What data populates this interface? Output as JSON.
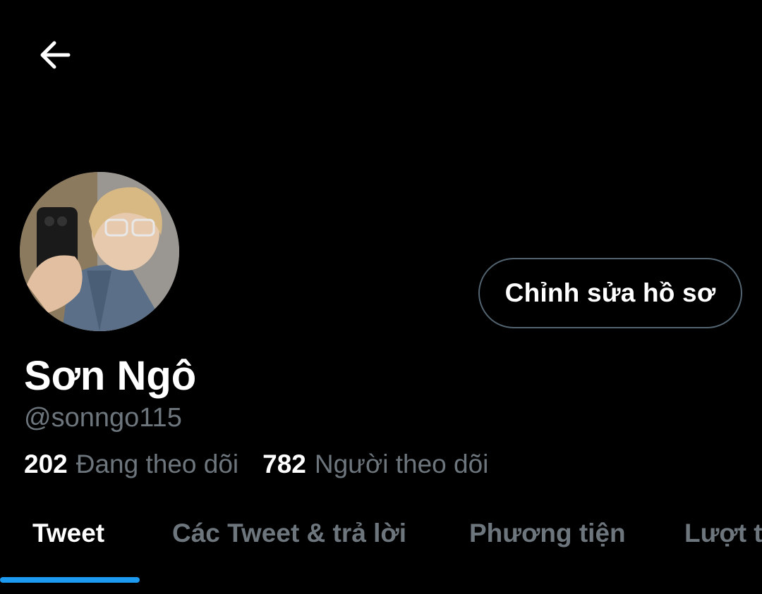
{
  "header": {
    "back_icon": "arrow-left-icon"
  },
  "profile": {
    "display_name": "Sơn Ngô",
    "handle": "@sonngo115",
    "edit_button_label": "Chỉnh sửa hồ sơ",
    "following_count": "202",
    "following_label": "Đang theo dõi",
    "followers_count": "782",
    "followers_label": "Người theo dõi"
  },
  "tabs": [
    {
      "label": "Tweet",
      "active": true
    },
    {
      "label": "Các Tweet & trả lời",
      "active": false
    },
    {
      "label": "Phương tiện",
      "active": false
    },
    {
      "label": "Lượt thích",
      "active": false
    }
  ],
  "colors": {
    "background": "#000000",
    "text_primary": "#ffffff",
    "text_secondary": "#6e767d",
    "border": "#536471",
    "accent": "#1d9bf0"
  }
}
